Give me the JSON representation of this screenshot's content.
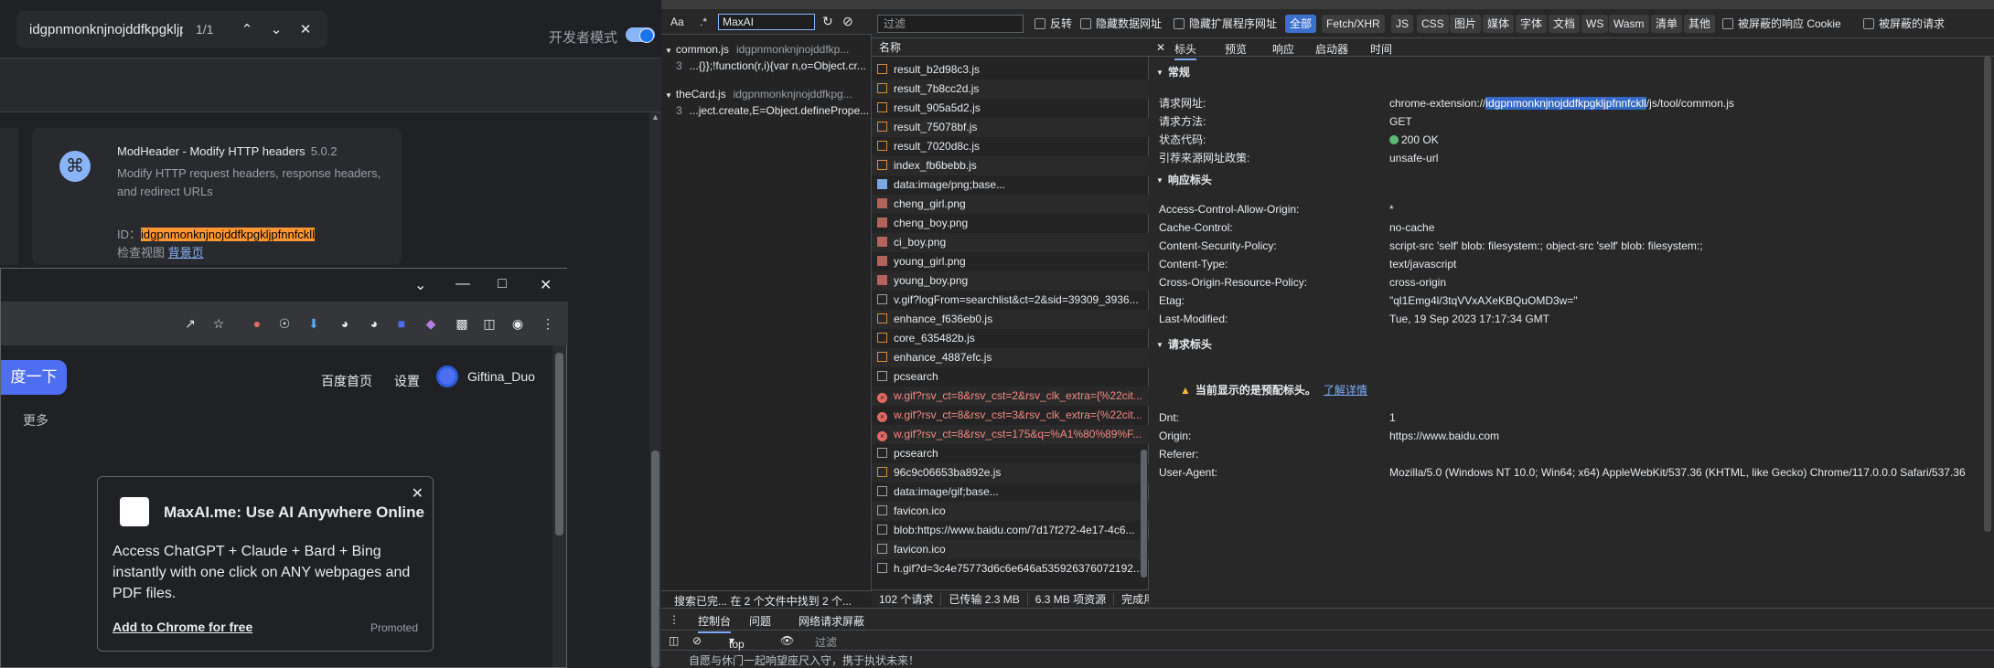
{
  "find": {
    "query": "idgpnmonknjnojddfkpgkljpfnf",
    "count": "1/1",
    "prev_icon": "chevron-up",
    "next_icon": "chevron-down",
    "close_icon": "close"
  },
  "extensions_page": {
    "dev_mode_label": "开发者模式",
    "card": {
      "title": "ModHeader - Modify HTTP headers",
      "version": "5.0.2",
      "description": "Modify HTTP request headers, response headers, and redirect URLs",
      "id_label": "ID：",
      "id_value": "idgpnmonknjnojddfkpgkljpfnnfckll",
      "inspect_label": "检查视图",
      "inspect_link": "背景页"
    }
  },
  "browser": {
    "search_button": "度一下",
    "more_link": "更多",
    "nav": [
      "百度首页",
      "设置"
    ],
    "username": "Giftina_Duo",
    "popup": {
      "title": "MaxAI.me: Use AI Anywhere Online",
      "text": "Access ChatGPT + Claude + Bard + Bing instantly with one click on ANY webpages and PDF files.",
      "cta": "Add to Chrome for free",
      "promoted": "Promoted"
    }
  },
  "devtools": {
    "search": {
      "aa": "Aa",
      "regex": ".*",
      "query": "MaxAI",
      "results": [
        {
          "file": "common.js",
          "path": "idgpnmonknjnojddfkp...",
          "line": "3",
          "match": "...{}};!function(r,i){var n,o=Object.cr..."
        },
        {
          "file": "theCard.js",
          "path": "idgpnmonknjnojddfkpg...",
          "line": "3",
          "match": "...ject.create,E=Object.definePrope..."
        }
      ],
      "status": "搜索已完... 在 2 个文件中找到 2 个..."
    },
    "filter": {
      "placeholder": "过滤",
      "invert": "反转",
      "hide_data_urls": "隐藏数据网址",
      "hide_extension_urls": "隐藏扩展程序网址",
      "types": [
        "全部",
        "Fetch/XHR",
        "JS",
        "CSS",
        "图片",
        "媒体",
        "字体",
        "文档",
        "WS",
        "Wasm",
        "清单",
        "其他"
      ],
      "blocked_cookies": "被屏蔽的响应 Cookie",
      "blocked_requests": "被屏蔽的请求"
    },
    "list": {
      "header": "名称",
      "rows": [
        {
          "name": "result_b2d98c3.js",
          "kind": "js"
        },
        {
          "name": "result_7b8cc2d.js",
          "kind": "js"
        },
        {
          "name": "result_905a5d2.js",
          "kind": "js"
        },
        {
          "name": "result_75078bf.js",
          "kind": "js"
        },
        {
          "name": "result_7020d8c.js",
          "kind": "js"
        },
        {
          "name": "index_fb6bebb.js",
          "kind": "js"
        },
        {
          "name": "data:image/png;base...",
          "kind": "data"
        },
        {
          "name": "cheng_girl.png",
          "kind": "img"
        },
        {
          "name": "cheng_boy.png",
          "kind": "img"
        },
        {
          "name": "ci_boy.png",
          "kind": "img"
        },
        {
          "name": "young_girl.png",
          "kind": "img"
        },
        {
          "name": "young_boy.png",
          "kind": "img"
        },
        {
          "name": "v.gif?logFrom=searchlist&ct=2&sid=39309_3936...",
          "kind": "doc"
        },
        {
          "name": "enhance_f636eb0.js",
          "kind": "js"
        },
        {
          "name": "core_635482b.js",
          "kind": "js"
        },
        {
          "name": "enhance_4887efc.js",
          "kind": "js"
        },
        {
          "name": "pcsearch",
          "kind": "blank"
        },
        {
          "name": "w.gif?rsv_ct=8&rsv_cst=2&rsv_clk_extra={%22cit...",
          "kind": "err"
        },
        {
          "name": "w.gif?rsv_ct=8&rsv_cst=3&rsv_clk_extra={%22cit...",
          "kind": "err"
        },
        {
          "name": "w.gif?rsv_ct=8&rsv_cst=175&q=%A1%80%89%F...",
          "kind": "err"
        },
        {
          "name": "pcsearch",
          "kind": "blank"
        },
        {
          "name": "96c9c06653ba892e.js",
          "kind": "js"
        },
        {
          "name": "data:image/gif;base...",
          "kind": "doc"
        },
        {
          "name": "favicon.ico",
          "kind": "blank"
        },
        {
          "name": "blob:https://www.baidu.com/7d17f272-4e17-4c6...",
          "kind": "blank"
        },
        {
          "name": "favicon.ico",
          "kind": "blank"
        },
        {
          "name": "h.gif?d=3c4e75773d6c6e646a535926376072192...",
          "kind": "doc"
        }
      ],
      "status": [
        "102 个请求",
        "已传输 2.3 MB",
        "6.3 MB 项资源",
        "完成用"
      ]
    },
    "detail": {
      "tabs": [
        "标头",
        "预览",
        "响应",
        "启动器",
        "时间"
      ],
      "general_title": "常规",
      "general": [
        {
          "k": "请求网址:",
          "v_pre": "chrome-extension://",
          "v_hl": "idgpnmonknjnojddfkpgkljpfnnfckll",
          "v_post": "/js/tool/common.js"
        },
        {
          "k": "请求方法:",
          "v": "GET"
        },
        {
          "k": "状态代码:",
          "v": "200 OK"
        },
        {
          "k": "引荐来源网址政策:",
          "v": "unsafe-url"
        }
      ],
      "response_title": "响应标头",
      "response": [
        {
          "k": "Access-Control-Allow-Origin:",
          "v": "*"
        },
        {
          "k": "Cache-Control:",
          "v": "no-cache"
        },
        {
          "k": "Content-Security-Policy:",
          "v": "script-src 'self' blob: filesystem:; object-src 'self' blob: filesystem:;"
        },
        {
          "k": "Content-Type:",
          "v": "text/javascript"
        },
        {
          "k": "Cross-Origin-Resource-Policy:",
          "v": "cross-origin"
        },
        {
          "k": "Etag:",
          "v": "\"ql1Emg4l/3tqVVxAXeKBQuOMD3w=\""
        },
        {
          "k": "Last-Modified:",
          "v": "Tue, 19 Sep 2023 17:17:34 GMT"
        }
      ],
      "request_title": "请求标头",
      "warning": "当前显示的是预配标头。",
      "warning_link": "了解详情",
      "request": [
        {
          "k": "Dnt:",
          "v": "1"
        },
        {
          "k": "Origin:",
          "v": "https://www.baidu.com"
        },
        {
          "k": "Referer:",
          "v": ""
        },
        {
          "k": "User-Agent:",
          "v": "Mozilla/5.0 (Windows NT 10.0; Win64; x64) AppleWebKit/537.36 (KHTML, like Gecko) Chrome/117.0.0.0 Safari/537.36"
        }
      ]
    },
    "drawer": {
      "tabs": [
        "控制台",
        "问题",
        "网络请求屏蔽"
      ],
      "context": "top",
      "filter": "过滤",
      "console_text": "自愿与休门一起响望座尺入守，携于执状未来！"
    }
  }
}
